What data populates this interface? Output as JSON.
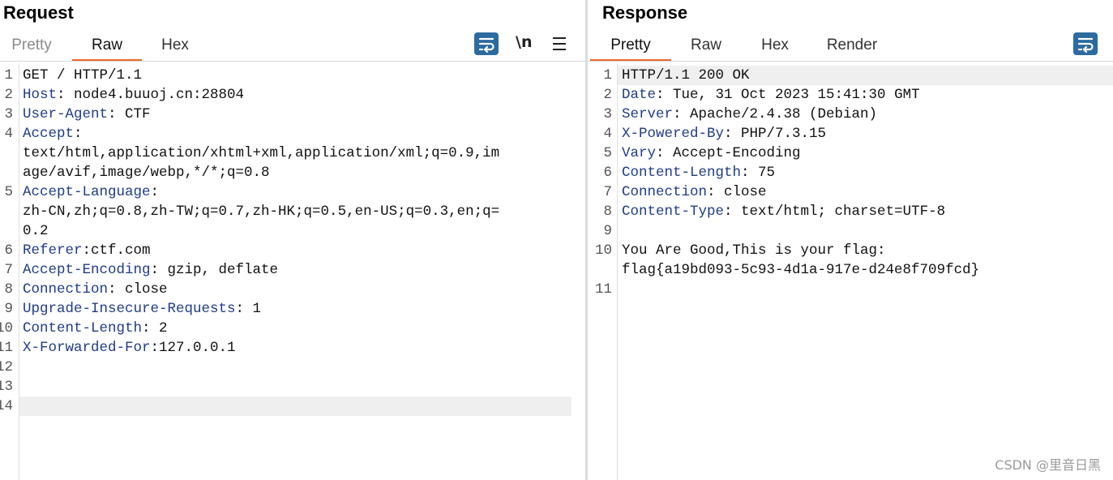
{
  "request": {
    "title": "Request",
    "tabs": [
      {
        "label": "Pretty",
        "state": "inactive-dim"
      },
      {
        "label": "Raw",
        "state": "active"
      },
      {
        "label": "Hex",
        "state": "inactive"
      }
    ],
    "toolbar": {
      "wrap_icon": "wrap-lines-icon",
      "newline_label": "\\n",
      "menu_icon": "hamburger-menu-icon"
    },
    "lines": [
      {
        "no": "1",
        "key": "",
        "rest": "GET / HTTP/1.1"
      },
      {
        "no": "2",
        "key": "Host",
        "rest": ": node4.buuoj.cn:28804"
      },
      {
        "no": "3",
        "key": "User-Agent",
        "rest": ": CTF"
      },
      {
        "no": "4",
        "key": "Accept",
        "rest": ":"
      },
      {
        "no": "",
        "key": "",
        "rest": "text/html,application/xhtml+xml,application/xml;q=0.9,im"
      },
      {
        "no": "",
        "key": "",
        "rest": "age/avif,image/webp,*/*;q=0.8"
      },
      {
        "no": "5",
        "key": "Accept-Language",
        "rest": ":"
      },
      {
        "no": "",
        "key": "",
        "rest": "zh-CN,zh;q=0.8,zh-TW;q=0.7,zh-HK;q=0.5,en-US;q=0.3,en;q="
      },
      {
        "no": "",
        "key": "",
        "rest": "0.2"
      },
      {
        "no": "6",
        "key": "Referer",
        "rest": ":ctf.com"
      },
      {
        "no": "7",
        "key": "Accept-Encoding",
        "rest": ": gzip, deflate"
      },
      {
        "no": "8",
        "key": "Connection",
        "rest": ": close"
      },
      {
        "no": "9",
        "key": "Upgrade-Insecure-Requests",
        "rest": ": 1"
      },
      {
        "no": "10",
        "key": "Content-Length",
        "rest": ": 2"
      },
      {
        "no": "11",
        "key": "X-Forwarded-For",
        "rest": ":127.0.0.1"
      },
      {
        "no": "12",
        "key": "",
        "rest": ""
      },
      {
        "no": "13",
        "key": "",
        "rest": ""
      },
      {
        "no": "14",
        "key": "",
        "rest": "",
        "current": true
      }
    ]
  },
  "response": {
    "title": "Response",
    "tabs": [
      {
        "label": "Pretty",
        "state": "active"
      },
      {
        "label": "Raw",
        "state": "inactive"
      },
      {
        "label": "Hex",
        "state": "inactive"
      },
      {
        "label": "Render",
        "state": "inactive"
      }
    ],
    "toolbar": {
      "wrap_icon": "wrap-lines-icon"
    },
    "lines": [
      {
        "no": "1",
        "key": "",
        "rest": "HTTP/1.1 200 OK",
        "current": true
      },
      {
        "no": "2",
        "key": "Date",
        "rest": ": Tue, 31 Oct 2023 15:41:30 GMT"
      },
      {
        "no": "3",
        "key": "Server",
        "rest": ": Apache/2.4.38 (Debian)"
      },
      {
        "no": "4",
        "key": "X-Powered-By",
        "rest": ": PHP/7.3.15"
      },
      {
        "no": "5",
        "key": "Vary",
        "rest": ": Accept-Encoding"
      },
      {
        "no": "6",
        "key": "Content-Length",
        "rest": ": 75"
      },
      {
        "no": "7",
        "key": "Connection",
        "rest": ": close"
      },
      {
        "no": "8",
        "key": "Content-Type",
        "rest": ": text/html; charset=UTF-8"
      },
      {
        "no": "9",
        "key": "",
        "rest": ""
      },
      {
        "no": "10",
        "key": "",
        "rest": "You Are Good,This is your flag:"
      },
      {
        "no": "",
        "key": "",
        "rest": "flag{a19bd093-5c93-4d1a-917e-d24e8f709fcd}"
      },
      {
        "no": "11",
        "key": "",
        "rest": ""
      }
    ]
  },
  "watermark": "CSDN @里音日黑",
  "colors": {
    "accent_tab": "#ec6a2c",
    "header_key": "#1f3c88",
    "button_blue": "#2c6aa0"
  }
}
